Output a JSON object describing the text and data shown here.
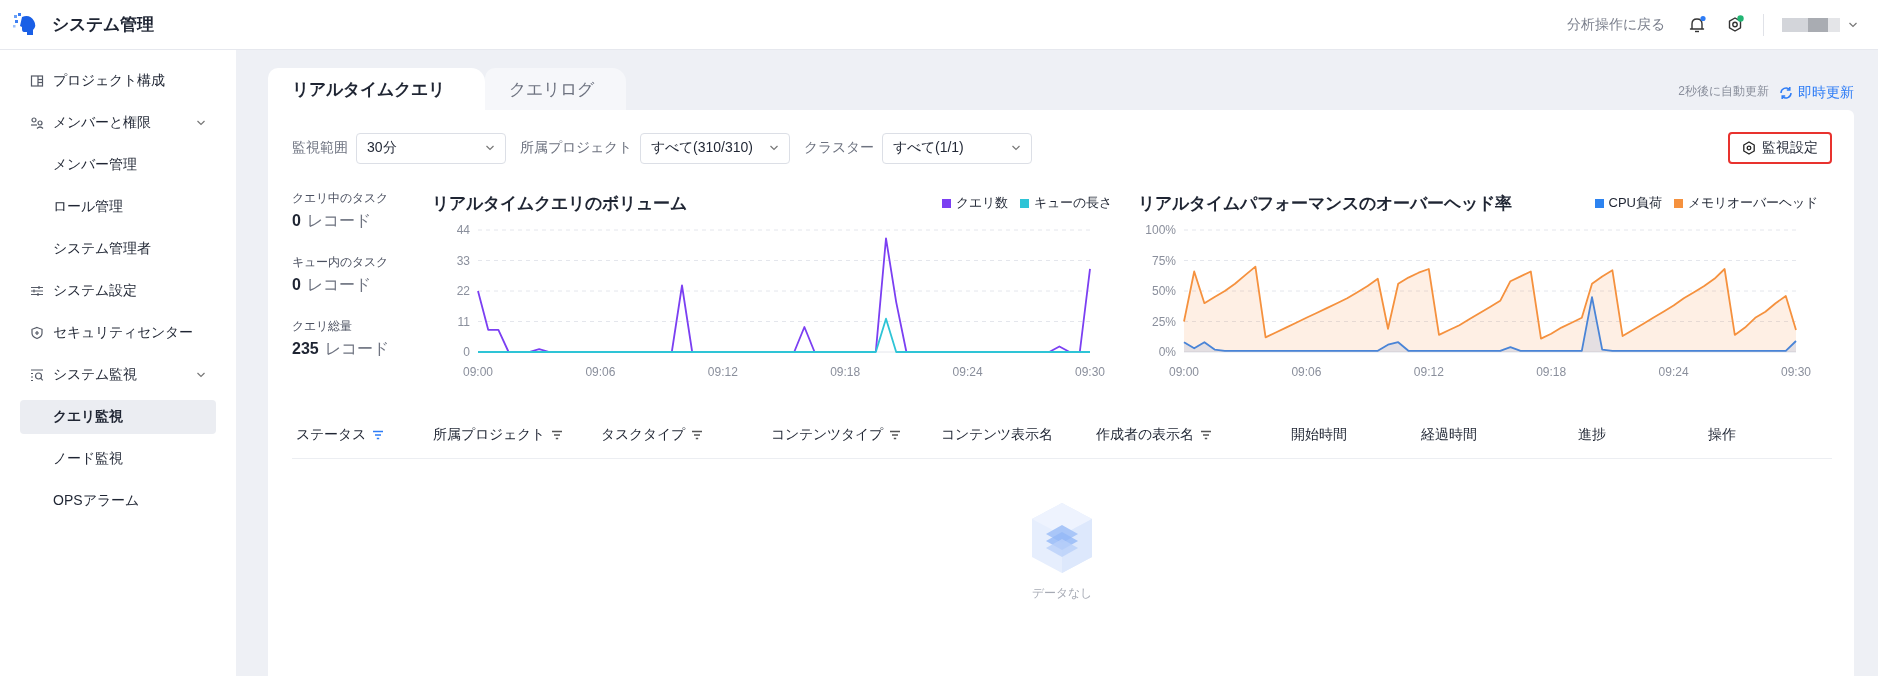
{
  "app": {
    "title": "システム管理"
  },
  "header": {
    "back_link": "分析操作に戻る",
    "notification_dot": true,
    "settings_badge": true
  },
  "sidebar": {
    "items": [
      {
        "label": "プロジェクト構成",
        "selected": false
      },
      {
        "label": "メンバーと権限",
        "selected": false,
        "expanded": true,
        "children": [
          {
            "label": "メンバー管理",
            "selected": false
          },
          {
            "label": "ロール管理",
            "selected": false
          },
          {
            "label": "システム管理者",
            "selected": false
          }
        ]
      },
      {
        "label": "システム設定",
        "selected": false
      },
      {
        "label": "セキュリティセンター",
        "selected": false
      },
      {
        "label": "システム監視",
        "selected": false,
        "expanded": true,
        "children": [
          {
            "label": "クエリ監視",
            "selected": true
          },
          {
            "label": "ノード監視",
            "selected": false
          },
          {
            "label": "OPSアラーム",
            "selected": false
          }
        ]
      }
    ]
  },
  "tabs": [
    {
      "label": "リアルタイムクエリ",
      "selected": true
    },
    {
      "label": "クエリログ",
      "selected": false
    }
  ],
  "refresh": {
    "note": "2秒後に自動更新",
    "link": "即時更新"
  },
  "filters": [
    {
      "label": "監視範囲",
      "value": "30分"
    },
    {
      "label": "所属プロジェクト",
      "value": "すべて(310/310)"
    },
    {
      "label": "クラスター",
      "value": "すべて(1/1)"
    }
  ],
  "settings_button": {
    "label": "監視設定",
    "highlighted": true
  },
  "stats": [
    {
      "label": "クエリ中のタスク",
      "value": "0",
      "unit": "レコード"
    },
    {
      "label": "キュー内のタスク",
      "value": "0",
      "unit": "レコード"
    },
    {
      "label": "クエリ総量",
      "value": "235",
      "unit": "レコード"
    }
  ],
  "charts": [
    {
      "chart_data": {
        "type": "line",
        "title": "リアルタイムクエリのボリューム",
        "categories": [
          "09:00",
          null,
          null,
          null,
          null,
          null,
          null,
          null,
          null,
          null,
          null,
          null,
          "09:06",
          null,
          null,
          null,
          null,
          null,
          null,
          null,
          null,
          null,
          null,
          null,
          "09:12",
          null,
          null,
          null,
          null,
          null,
          null,
          null,
          null,
          null,
          null,
          null,
          "09:18",
          null,
          null,
          null,
          null,
          null,
          null,
          null,
          null,
          null,
          null,
          null,
          "09:24",
          null,
          null,
          null,
          null,
          null,
          null,
          null,
          null,
          null,
          null,
          null,
          "09:30"
        ],
        "series": [
          {
            "name": "クエリ数",
            "color": "#7b3ff2",
            "values": [
              22,
              8,
              8,
              0,
              null,
              0,
              1,
              0,
              null,
              null,
              null,
              null,
              null,
              null,
              null,
              null,
              null,
              null,
              null,
              0,
              24,
              0,
              null,
              null,
              null,
              null,
              null,
              null,
              null,
              null,
              null,
              0,
              9,
              0,
              null,
              null,
              null,
              null,
              null,
              0,
              41,
              18,
              0,
              null,
              null,
              null,
              null,
              null,
              null,
              null,
              null,
              null,
              null,
              null,
              null,
              null,
              0,
              2,
              0,
              0,
              30
            ]
          },
          {
            "name": "キューの長さ",
            "color": "#2ec4d6",
            "values": [
              0,
              0,
              0,
              0,
              0,
              0,
              0,
              0,
              0,
              0,
              0,
              0,
              0,
              0,
              0,
              0,
              0,
              0,
              0,
              0,
              0,
              0,
              0,
              0,
              0,
              0,
              0,
              0,
              0,
              0,
              0,
              0,
              0,
              0,
              0,
              0,
              0,
              0,
              0,
              0,
              12,
              0,
              0,
              0,
              0,
              0,
              0,
              0,
              0,
              0,
              0,
              0,
              0,
              0,
              0,
              0,
              0,
              0,
              0,
              0,
              0
            ]
          }
        ],
        "ylim": [
          0,
          44
        ],
        "grid": true,
        "yticks": [
          0,
          11,
          22,
          33,
          44
        ]
      }
    },
    {
      "chart_data": {
        "type": "area",
        "title": "リアルタイムパフォーマンスのオーバーヘッド率",
        "categories": [
          "09:00",
          null,
          null,
          null,
          null,
          null,
          null,
          null,
          null,
          null,
          null,
          null,
          "09:06",
          null,
          null,
          null,
          null,
          null,
          null,
          null,
          null,
          null,
          null,
          null,
          "09:12",
          null,
          null,
          null,
          null,
          null,
          null,
          null,
          null,
          null,
          null,
          null,
          "09:18",
          null,
          null,
          null,
          null,
          null,
          null,
          null,
          null,
          null,
          null,
          null,
          "09:24",
          null,
          null,
          null,
          null,
          null,
          null,
          null,
          null,
          null,
          null,
          null,
          "09:30"
        ],
        "series": [
          {
            "name": "CPU負荷",
            "color": "#2d83f0",
            "values": [
              8,
              3,
              8,
              2,
              1,
              1,
              1,
              1,
              1,
              1,
              1,
              1,
              1,
              1,
              1,
              1,
              1,
              1,
              1,
              1,
              6,
              8,
              1,
              1,
              1,
              1,
              1,
              1,
              1,
              1,
              1,
              1,
              4,
              1,
              1,
              1,
              1,
              1,
              1,
              1,
              45,
              2,
              1,
              1,
              1,
              1,
              1,
              1,
              1,
              1,
              1,
              1,
              1,
              1,
              1,
              1,
              1,
              1,
              1,
              1,
              9
            ]
          },
          {
            "name": "メモリオーバーヘッド",
            "color": "#f5913e",
            "values": [
              25,
              66,
              40,
              45,
              50,
              56,
              63,
              70,
              12,
              16,
              20,
              24,
              28,
              32,
              36,
              40,
              44,
              49,
              54,
              60,
              19,
              56,
              61,
              65,
              68,
              14,
              18,
              22,
              27,
              32,
              37,
              42,
              58,
              62,
              66,
              11,
              15,
              20,
              24,
              28,
              56,
              62,
              67,
              13,
              18,
              23,
              28,
              33,
              38,
              44,
              49,
              54,
              60,
              68,
              14,
              20,
              28,
              33,
              40,
              46,
              18
            ]
          }
        ],
        "ylim": [
          0,
          100
        ],
        "grid": true,
        "yticks": [
          {
            "value": 0,
            "label": "0%"
          },
          {
            "value": 25,
            "label": "25%"
          },
          {
            "value": 50,
            "label": "50%"
          },
          {
            "value": 75,
            "label": "75%"
          },
          {
            "value": 100,
            "label": "100%"
          }
        ]
      }
    }
  ],
  "table": {
    "columns": [
      {
        "label": "ステータス",
        "filter": true,
        "filter_active": true
      },
      {
        "label": "所属プロジェクト",
        "filter": true,
        "filter_active": false
      },
      {
        "label": "タスクタイプ",
        "filter": true,
        "filter_active": false
      },
      {
        "label": "コンテンツタイプ",
        "filter": true,
        "filter_active": false
      },
      {
        "label": "コンテンツ表示名",
        "filter": false
      },
      {
        "label": "作成者の表示名",
        "filter": true,
        "filter_active": false
      },
      {
        "label": "開始時間",
        "filter": false
      },
      {
        "label": "経過時間",
        "filter": false
      },
      {
        "label": "進捗",
        "filter": false
      },
      {
        "label": "操作",
        "filter": false
      }
    ],
    "empty_text": "データなし"
  }
}
